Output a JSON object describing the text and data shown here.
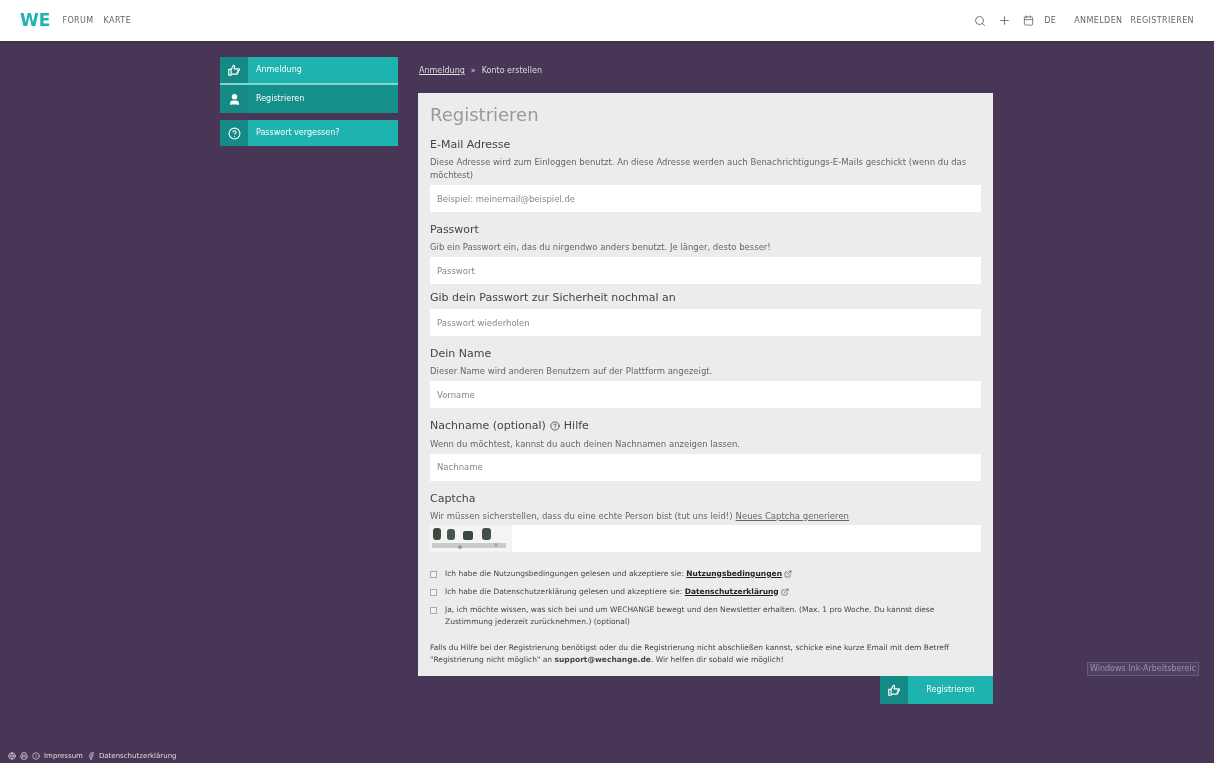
{
  "topbar": {
    "logo": "WE",
    "nav": [
      "FORUM",
      "KARTE"
    ],
    "language": "DE",
    "links": [
      "ANMELDEN",
      "REGISTRIEREN"
    ]
  },
  "sidebar": {
    "items": [
      {
        "label": "Anmeldung",
        "selected": false
      },
      {
        "label": "Registrieren",
        "selected": true
      }
    ],
    "extra": {
      "label": "Passwort vergessen?"
    }
  },
  "breadcrumb": {
    "link": "Anmeldung",
    "separator": "»",
    "current": "Konto erstellen"
  },
  "form": {
    "title": "Registrieren",
    "fields": [
      {
        "label": "E-Mail Adresse",
        "hint": "Diese Adresse wird zum Einloggen benutzt. An diese Adresse werden auch Benachrichtigungs-E-Mails geschickt (wenn du das möchtest)",
        "placeholder": "Beispiel: meinemail@beispiel.de"
      },
      {
        "label": "Passwort",
        "hint": "Gib ein Passwort ein, das du nirgendwo anders benutzt. Je länger, desto besser!",
        "placeholder": "Passwort"
      },
      {
        "label": "Gib dein Passwort zur Sicherheit nochmal an",
        "placeholder": "Passwort wiederholen"
      },
      {
        "label": "Dein Name",
        "hint": "Dieser Name wird anderen Benutzern auf der Plattform angezeigt.",
        "placeholder": "Vorname"
      },
      {
        "label": "Nachname (optional)",
        "help": "Hilfe",
        "hint": "Wenn du möchtest, kannst du auch deinen Nachnamen anzeigen lassen.",
        "placeholder": "Nachname"
      }
    ],
    "captcha": {
      "label": "Captcha",
      "hint": "Wir müssen sicherstellen, dass du eine echte Person bist (tut uns leid!)",
      "link": "Neues Captcha generieren"
    },
    "checkboxes": [
      {
        "text": "Ich habe die Nutzungsbedingungen gelesen und akzeptiere sie:",
        "link": "Nutzungsbedingungen",
        "checked": false
      },
      {
        "text": "Ich habe die Datenschutzerklärung gelesen und akzeptiere sie:",
        "link": "Datenschutzerklärung",
        "checked": false
      },
      {
        "text": "Ja, ich möchte wissen, was sich bei und um WECHANGE bewegt und den Newsletter erhalten. (Max. 1 pro Woche. Du kannst diese Zustimmung jederzeit zurücknehmen.) (optional)",
        "checked": false
      }
    ],
    "note": "Falls du Hilfe bei der Registrierung benötigst oder du die Registrierung nicht abschließen kannst, schicke eine kurze Email mit dem Betreff \"Registrierung nicht möglich\" an **support@wechange.de**. Wir helfen dir sobald wie möglich!",
    "submit": "Registrieren"
  },
  "tooltip": "Windows Ink-Arbeitsbereic",
  "footer": {
    "links": [
      "Impressum",
      "Datenschutzerklärung"
    ]
  }
}
